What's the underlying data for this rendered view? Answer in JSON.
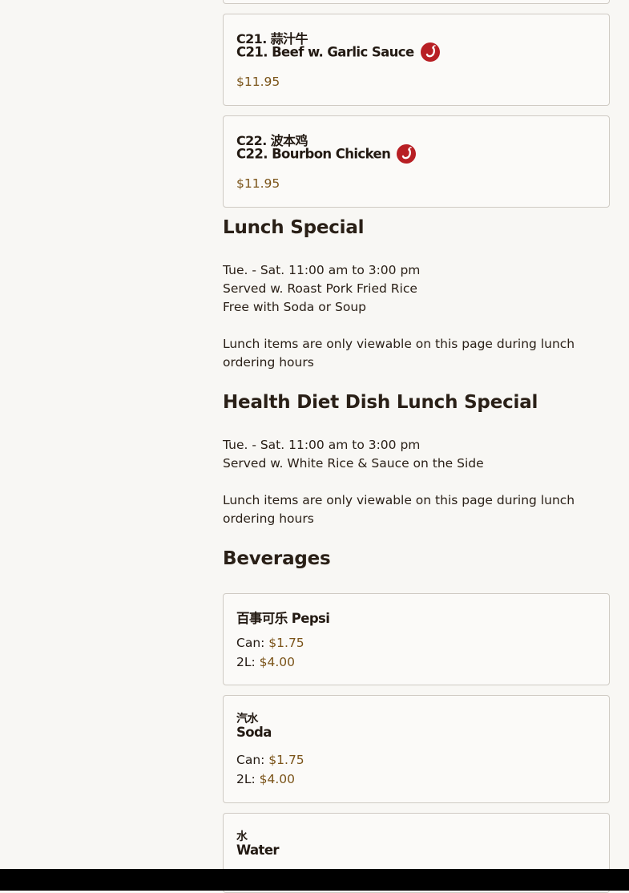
{
  "items": [
    {
      "cn": "C21. 蒜汁牛",
      "en": "C21. Beef w. Garlic Sauce",
      "spicy": true,
      "price": "$11.95"
    },
    {
      "cn": "C22. 波本鸡",
      "en": "C22. Bourbon Chicken",
      "spicy": true,
      "price": "$11.95"
    }
  ],
  "lunch": {
    "title": "Lunch Special",
    "line1": "Tue. - Sat. 11:00 am to 3:00 pm",
    "line2": "Served w. Roast Pork Fried Rice",
    "line3": "Free with Soda or Soup",
    "note": "Lunch items are only viewable on this page during lunch ordering hours"
  },
  "health": {
    "title": "Health Diet Dish Lunch Special",
    "line1": "Tue. - Sat. 11:00 am to 3:00 pm",
    "line2": "Served w. White Rice & Sauce on the Side",
    "note": "Lunch items are only viewable on this page during lunch ordering hours"
  },
  "beverages": {
    "title": "Beverages",
    "pepsi": {
      "name": "百事可乐 Pepsi",
      "can_label": "Can: ",
      "can_price": "$1.75",
      "l2_label": "2L: ",
      "l2_price": "$4.00"
    },
    "soda": {
      "cn": "汽水",
      "en": "Soda",
      "can_label": "Can: ",
      "can_price": "$1.75",
      "l2_label": "2L: ",
      "l2_price": "$4.00"
    },
    "water": {
      "cn": "水",
      "en": "Water"
    }
  },
  "colors": {
    "accent": "#7a5318",
    "spicy": "#b81f24",
    "border": "#cfcac3"
  }
}
